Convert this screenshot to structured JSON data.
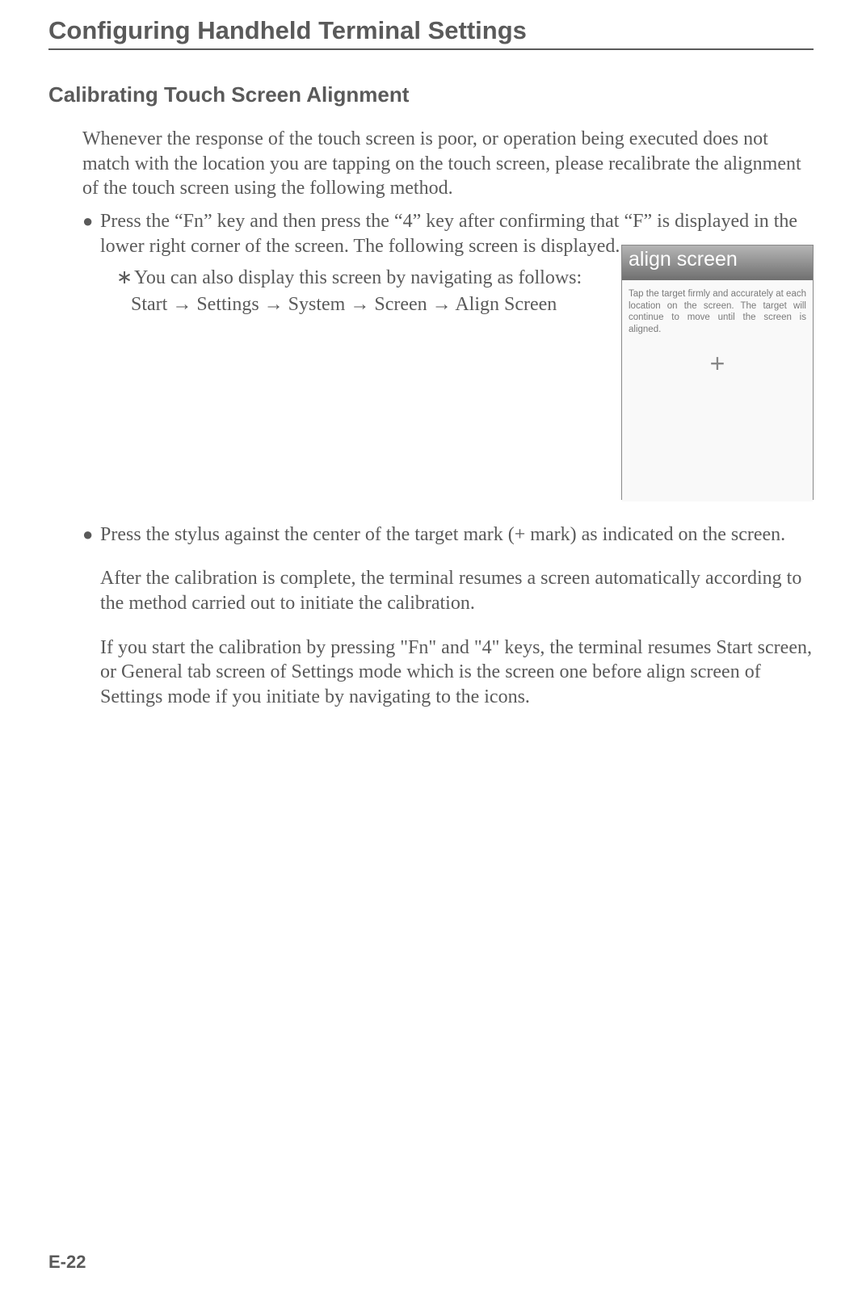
{
  "doc_title": "Configuring Handheld Terminal Settings",
  "section_title": "Calibrating Touch Screen Alignment",
  "intro": "Whenever the response of the touch screen is poor, or operation being executed does not match with the location you are tapping on the touch screen, please recalibrate the alignment of the touch screen using the following method.",
  "bullet1": "Press the “Fn” key and then press the “4” key after confirming that “F” is displayed in the lower right corner of the screen.  The following screen is displayed.",
  "asterisk_text": "You can also display this screen by navigating as follows:",
  "nav": {
    "start": "Start",
    "settings": "Settings",
    "system": "System",
    "screen": "Screen",
    "align": "Align Screen",
    "arrow": "→"
  },
  "screenshot": {
    "title": "align screen",
    "instructions": "Tap the target firmly and accurately at each location on the screen. The target will continue to move until the screen is aligned.",
    "cross": "+"
  },
  "bullet2": "Press the stylus against the center of the target mark (+ mark) as indicated on the screen.",
  "para1": "After the calibration is complete, the terminal resumes a screen automatically according to the method carried out to initiate the calibration.",
  "para2": "If you start the calibration by pressing \"Fn\" and \"4\" keys, the terminal resumes Start screen, or General tab screen of Settings mode which is the screen one before align screen of Settings mode if you initiate by navigating to the icons.",
  "page_number": "E-22"
}
